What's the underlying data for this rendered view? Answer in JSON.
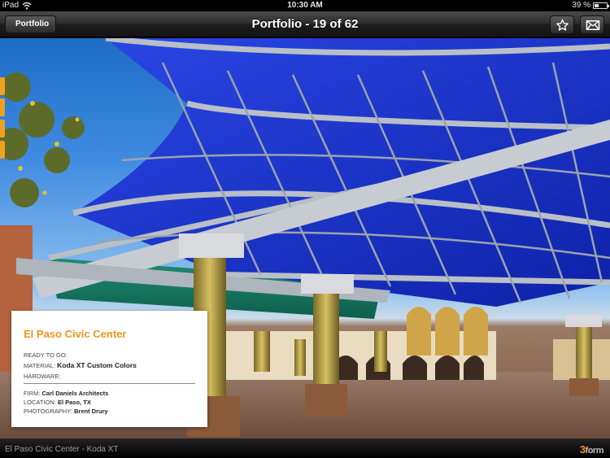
{
  "status_bar": {
    "carrier": "iPad",
    "time": "10:30 AM",
    "battery_text": "39 %",
    "battery_level": 0.39
  },
  "nav": {
    "back_label": "Portfolio",
    "title": "Portfolio - 19 of 62"
  },
  "photo": {
    "subject": "El Paso Civic Center canopy"
  },
  "info": {
    "title": "El Paso Civic Center",
    "ready_label": "READY TO GO:",
    "ready_value": "",
    "material_label": "MATERIAL:",
    "material_value": "Koda XT Custom Colors",
    "hardware_label": "HARDWARE:",
    "hardware_value": "",
    "firm_label": "FIRM:",
    "firm_value": "Carl Daniels Architects",
    "location_label": "LOCATION:",
    "location_value": "El Paso, TX",
    "photography_label": "PHOTOGRAPHY:",
    "photography_value": "Brent Drury"
  },
  "bottom": {
    "caption": "El Paso Civic Center - Koda XT",
    "brand_num": "3",
    "brand_word": "form"
  },
  "colors": {
    "accent": "#f0941d",
    "canopy_blue": "#1e3fd8"
  }
}
